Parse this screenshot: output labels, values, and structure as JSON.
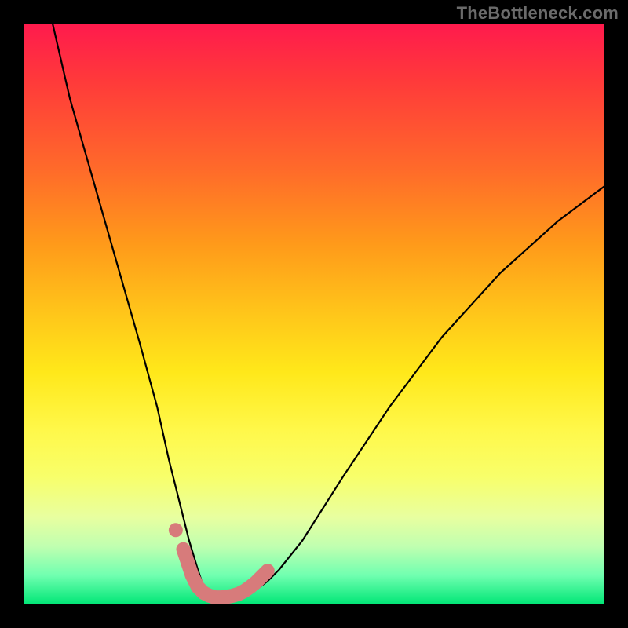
{
  "watermark": "TheBottleneck.com",
  "chart_data": {
    "type": "line",
    "title": "",
    "xlabel": "",
    "ylabel": "",
    "xlim": [
      0,
      100
    ],
    "ylim": [
      0,
      100
    ],
    "grid": false,
    "legend": false,
    "series": [
      {
        "name": "bottleneck-curve",
        "color": "#000000",
        "x": [
          5,
          8,
          12,
          16,
          20,
          23,
          25,
          27,
          28.5,
          30,
          31,
          32,
          33,
          34,
          36,
          38,
          40,
          42,
          44,
          48,
          55,
          63,
          72,
          82,
          92,
          100
        ],
        "y": [
          100,
          87,
          73,
          59,
          45,
          34,
          25,
          17,
          11,
          6,
          3,
          1.5,
          1,
          1,
          1,
          1.5,
          2.5,
          4,
          6,
          11,
          22,
          34,
          46,
          57,
          66,
          72
        ]
      },
      {
        "name": "highlight-band",
        "color": "#d77b7b",
        "x": [
          27.5,
          29,
          30,
          31,
          32,
          33,
          34,
          35,
          36,
          37,
          38,
          39,
          40,
          41,
          42
        ],
        "y": [
          9.5,
          5,
          3,
          2,
          1.5,
          1.2,
          1.2,
          1.3,
          1.5,
          1.8,
          2.3,
          3,
          3.8,
          4.8,
          5.8
        ]
      },
      {
        "name": "highlight-dot",
        "color": "#d77b7b",
        "x": [
          26.2
        ],
        "y": [
          12.8
        ]
      }
    ],
    "background_gradient": {
      "top": "#ff1a4d",
      "bottom": "#00e676"
    }
  }
}
